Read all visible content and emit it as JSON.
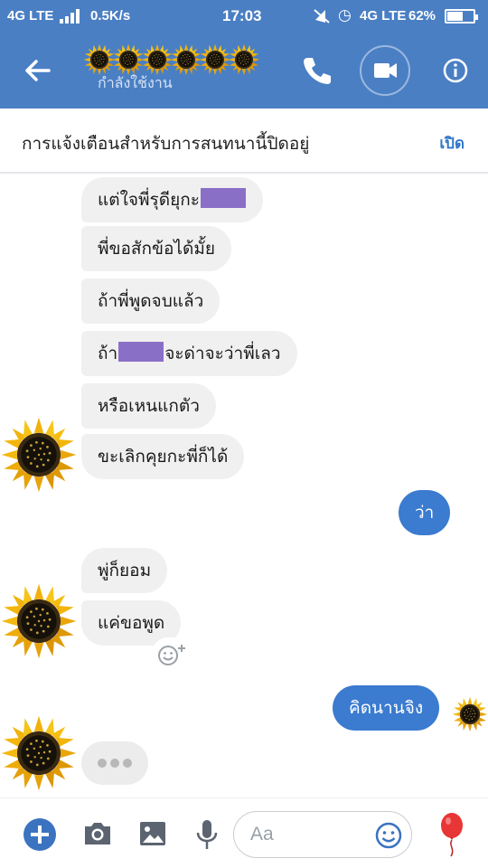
{
  "status_bar": {
    "network": "4G LTE",
    "speed": "0.5K/s",
    "time": "17:03",
    "network2": "4G LTE",
    "battery": "62%",
    "battery_level": 0.62
  },
  "header": {
    "contact_name_icon": "sunflower-emoji-row",
    "subtitle": "กำลังใช้งาน",
    "back_icon": "arrow-left-icon",
    "call_icon": "phone-icon",
    "video_icon": "video-camera-icon",
    "info_icon": "info-icon",
    "accent_color": "#4a7fc4"
  },
  "notice": {
    "text": "การแจ้งเตือนสำหรับการสนทนานี้ปิดอยู่",
    "action": "เปิด"
  },
  "messages": {
    "m1": {
      "before": "แต่ใจพี่รุดียุกะ",
      "after": ""
    },
    "m2": "พี่ขอสักข้อได้มั้ย",
    "m3": "ถ้าพี่พูดจบแล้ว",
    "m4": {
      "before": "ถ้า",
      "after": "จะด่าจะว่าพี่เลว"
    },
    "m5": "หรือเหนแกตัว",
    "m6": "ขะเลิกคุยกะพี่ก็ได้",
    "m7": "ว่า",
    "m8": "พู่ก็ยอม",
    "m9": "แค่ขอพูด",
    "m10": "คิดนานจิง",
    "incoming_color": "#f1f0f0",
    "outgoing_color": "#3b7bd0"
  },
  "composer": {
    "placeholder": "Aa",
    "icons": [
      "plus-icon",
      "camera-icon",
      "image-icon",
      "microphone-icon",
      "emoji-icon",
      "balloon-icon"
    ]
  }
}
